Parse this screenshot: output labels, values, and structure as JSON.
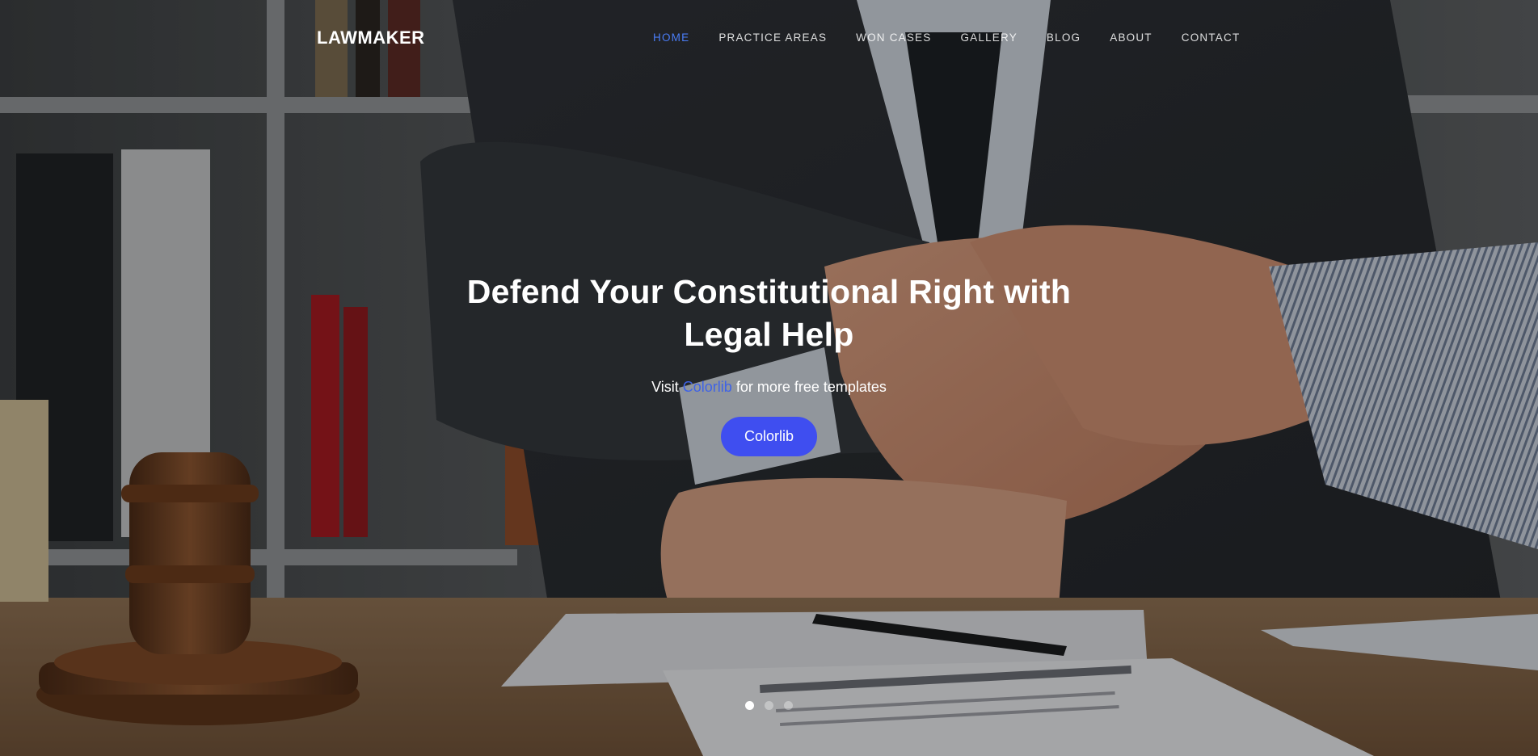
{
  "brand": {
    "name": "LAWMAKER"
  },
  "nav": {
    "items": [
      {
        "label": "HOME",
        "active": true
      },
      {
        "label": "PRACTICE AREAS",
        "active": false
      },
      {
        "label": "WON CASES",
        "active": false
      },
      {
        "label": "GALLERY",
        "active": false
      },
      {
        "label": "BLOG",
        "active": false
      },
      {
        "label": "ABOUT",
        "active": false
      },
      {
        "label": "CONTACT",
        "active": false
      }
    ],
    "active_color": "#4a7df7"
  },
  "hero": {
    "title": "Defend Your Constitutional Right with Legal Help",
    "subtitle_prefix": "Visit",
    "subtitle_link": "Colorlib",
    "subtitle_suffix": "for more free templates",
    "button_label": "Colorlib",
    "button_color": "#3f4ef0",
    "background_image": "handshake-gavel-contract-photo"
  },
  "carousel": {
    "slide_count": 3,
    "active_index": 0
  }
}
